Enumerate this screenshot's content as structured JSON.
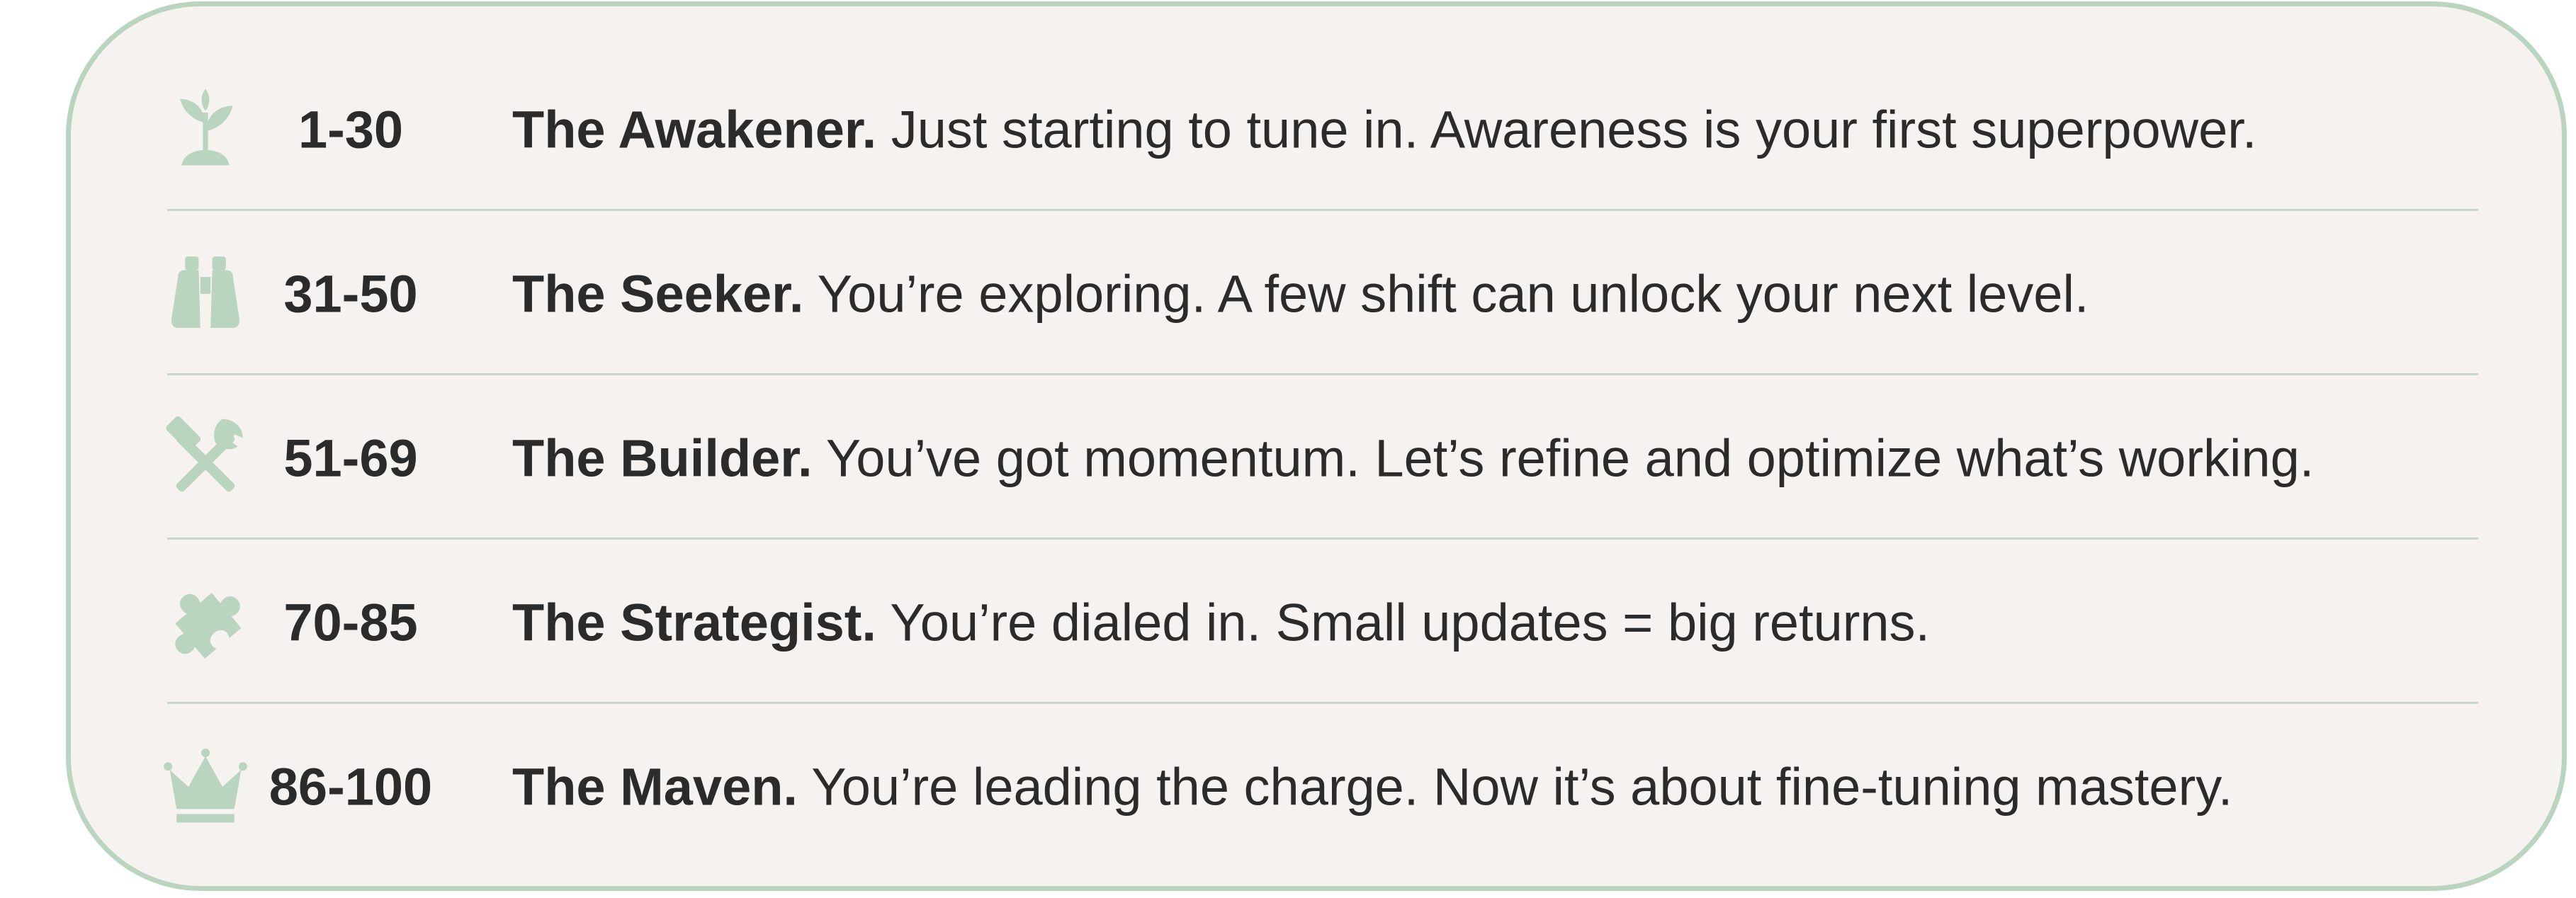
{
  "colors": {
    "card_background": "#f6f2ef",
    "card_border": "#b9d4bf",
    "icon": "#b9d4bf",
    "divider": "#c5d8ca",
    "text": "#2b2b2b"
  },
  "levels": [
    {
      "icon": "sprout-icon",
      "range": "1-30",
      "name": "The Awakener.",
      "description": " Just starting to tune in. Awareness is your first superpower."
    },
    {
      "icon": "binoculars-icon",
      "range": "31-50",
      "name": "The Seeker.",
      "description": " You’re exploring. A few shift can unlock your next level."
    },
    {
      "icon": "hammer-wrench-icon",
      "range": "51-69",
      "name": "The Builder.",
      "description": " You’ve got momentum. Let’s refine and optimize what’s working."
    },
    {
      "icon": "puzzle-piece-icon",
      "range": "70-85",
      "name": "The Strategist.",
      "description": " You’re dialed in. Small updates = big returns."
    },
    {
      "icon": "crown-icon",
      "range": "86-100",
      "name": "The Maven.",
      "description": " You’re leading the charge. Now it’s about fine-tuning mastery."
    }
  ]
}
